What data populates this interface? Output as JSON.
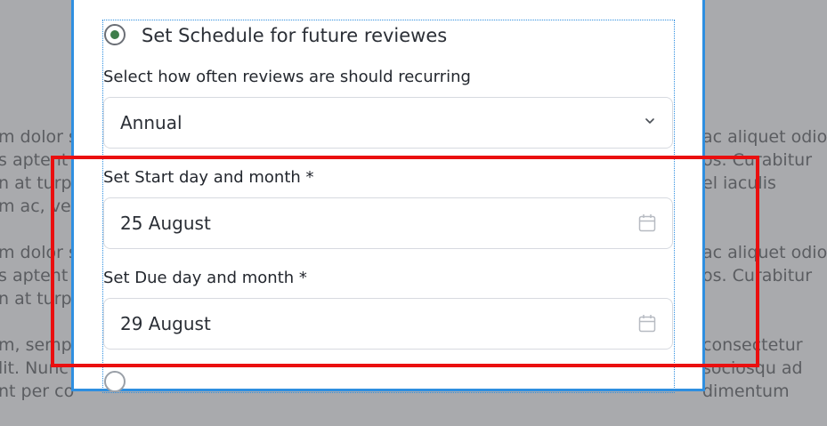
{
  "background": {
    "left_lines": [
      "m dolor s",
      "s aptent t",
      "n at turpis",
      "m ac, vest",
      "",
      "m dolor s",
      "s aptent t",
      "n at turpis",
      "",
      "m, semp",
      "lit. Nunc",
      "nt per co"
    ],
    "right_lines": [
      "ac aliquet odio",
      "os. Curabitur",
      "el iaculis",
      "",
      "",
      "ac aliquet odio",
      "os. Curabitur",
      "",
      "",
      "consectetur",
      "sociosqu ad",
      "dimentum"
    ]
  },
  "form": {
    "schedule_option_label": "Set Schedule for future reviewes",
    "frequency_label": "Select how often reviews are should recurring",
    "frequency_value": "Annual",
    "start_label": "Set Start day and month *",
    "start_value": "25 August",
    "due_label": "Set Due day and month *",
    "due_value": "29 August"
  },
  "colors": {
    "accent_border": "#2f8fe0",
    "radio_selected": "#3e7d4a",
    "highlight": "#ea0f0f"
  },
  "icons": {
    "frequency_dropdown": "chevron-down-icon",
    "start_picker": "calendar-icon",
    "due_picker": "calendar-icon"
  }
}
